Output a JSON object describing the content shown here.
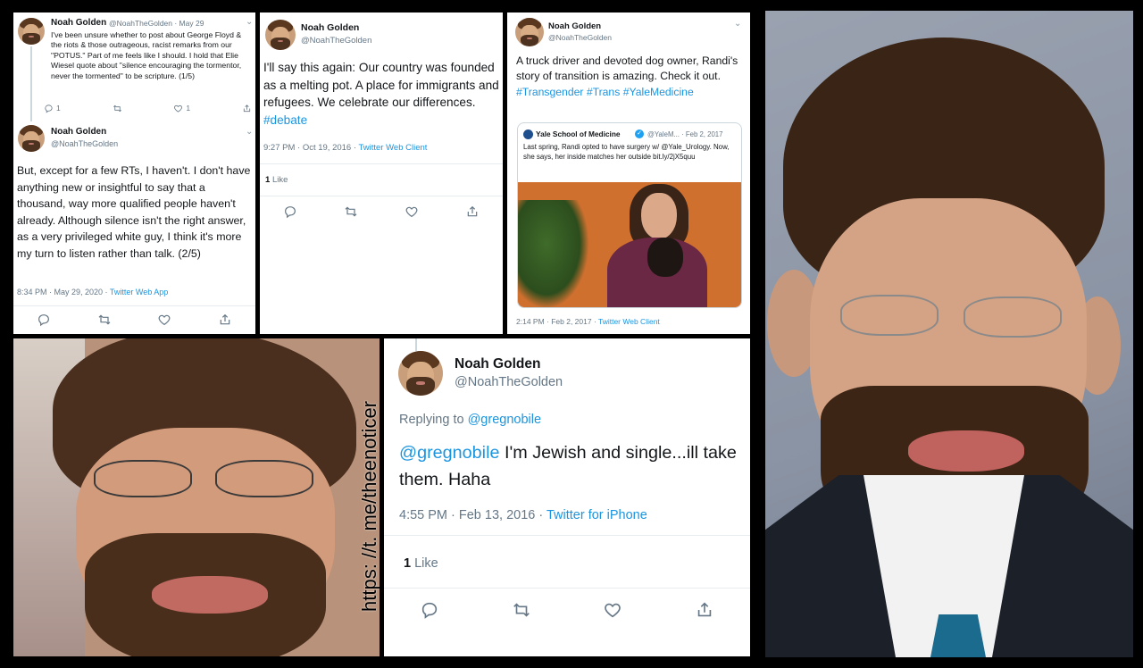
{
  "tweet1": {
    "name": "Noah Golden",
    "handle_date": "@NoahTheGolden · May 29",
    "text": "I've been unsure whether to post about George Floyd & the riots & those outrageous, racist remarks from our \"POTUS.\" Part of me feels like I should. I hold that Elie Wiesel quote about \"silence encouraging the tormentor, never the tormented\" to be scripture. (1/5)",
    "reply_count": "1",
    "like_count": "1"
  },
  "tweet2": {
    "name": "Noah Golden",
    "handle": "@NoahTheGolden",
    "text": "But, except for a few RTs, I haven't. I don't have anything new or insightful to say that a thousand, way more qualified people haven't already. Although silence isn't the right answer, as a very privileged white guy, I think it's more my turn to listen rather than talk. (2/5)",
    "time": "8:34 PM · May 29, 2020 · ",
    "client": "Twitter Web App"
  },
  "tweet3": {
    "name": "Noah Golden",
    "handle": "@NoahTheGolden",
    "text_main": "I'll say this again: Our country was founded as a melting pot. A place for immigrants and refugees. We celebrate our differences. ",
    "hashtag": "#debate",
    "time": "9:27 PM · Oct 19, 2016 · ",
    "client": "Twitter Web Client",
    "likes_num": "1",
    "likes_label": "Like"
  },
  "tweet4": {
    "name": "Noah Golden",
    "handle": "@NoahTheGolden",
    "text_main": "A truck driver and devoted dog owner, Randi's story of transition is amazing. Check it out. ",
    "hashtag1": "#Transgender",
    "hashtag2": "#Trans",
    "hashtag3": "#YaleMedicine",
    "quote_name": "Yale School of Medicine",
    "quote_handle_date": "@YaleM... · Feb 2, 2017",
    "quote_text": "Last spring, Randi opted to have surgery w/ @Yale_Urology. Now, she says, her inside matches her outside bit.ly/2jX5quu",
    "time": "2:14 PM · Feb 2, 2017 · ",
    "client": "Twitter Web Client"
  },
  "tweet5": {
    "name": "Noah Golden",
    "handle": "@NoahTheGolden",
    "replying_label": "Replying to ",
    "replying_to": "@gregnobile",
    "mention": "@gregnobile",
    "text": " I'm Jewish and single...ill take them. Haha",
    "time": "4:55 PM · Feb 13, 2016 · ",
    "client": "Twitter for iPhone",
    "likes_num": "1",
    "likes_label": "Like"
  },
  "watermark": "https: //t. me/theenoticer",
  "colors": {
    "link": "#1b95e0",
    "gray": "#657786",
    "border": "#e6ecf0",
    "background": "#000000"
  },
  "icons": [
    "reply-icon",
    "retweet-icon",
    "like-icon",
    "share-icon",
    "verified-icon",
    "chevron-down-icon"
  ]
}
